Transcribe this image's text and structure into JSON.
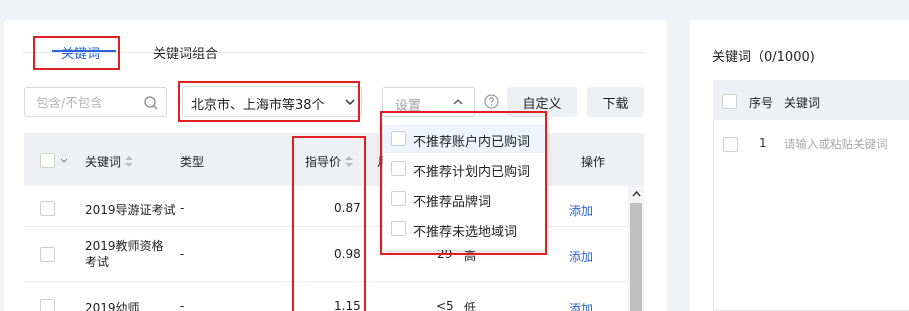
{
  "tabs": [
    {
      "label": "关键词",
      "active": true
    },
    {
      "label": "关键词组合",
      "active": false
    }
  ],
  "filter": {
    "search_placeholder": "包含/不包含",
    "region_value": "北京市、上海市等38个",
    "settings_placeholder": "设置",
    "custom_button": "自定义",
    "download_button": "下载"
  },
  "table": {
    "columns": {
      "keyword": "关键词",
      "type": "类型",
      "price": "指导价",
      "partial": "月",
      "action": "操作"
    },
    "rows": [
      {
        "keyword": "2019导游证考试",
        "type": "-",
        "price": "0.87",
        "volume": "",
        "competition": "",
        "action": "添加"
      },
      {
        "keyword": "2019教师资格考试",
        "type": "-",
        "price": "0.98",
        "volume": "29",
        "competition": "高",
        "action": "添加"
      },
      {
        "keyword": "2019幼师",
        "type": "-",
        "price": "1.15",
        "volume": "<5",
        "competition": "低",
        "action": "添加"
      }
    ]
  },
  "settings_dropdown": {
    "items": [
      {
        "label": "不推荐账户内已购词",
        "checked": false
      },
      {
        "label": "不推荐计划内已购词",
        "checked": false
      },
      {
        "label": "不推荐品牌词",
        "checked": false
      },
      {
        "label": "不推荐未选地域词",
        "checked": false
      }
    ]
  },
  "right_panel": {
    "title": "关键词（0/1000)",
    "col_index": "序号",
    "col_keyword": "关键词",
    "row_index": "1",
    "row_placeholder": "请输入或粘贴关键词"
  },
  "colors": {
    "accent": "#2a63d9",
    "highlight_box": "#e02020"
  }
}
